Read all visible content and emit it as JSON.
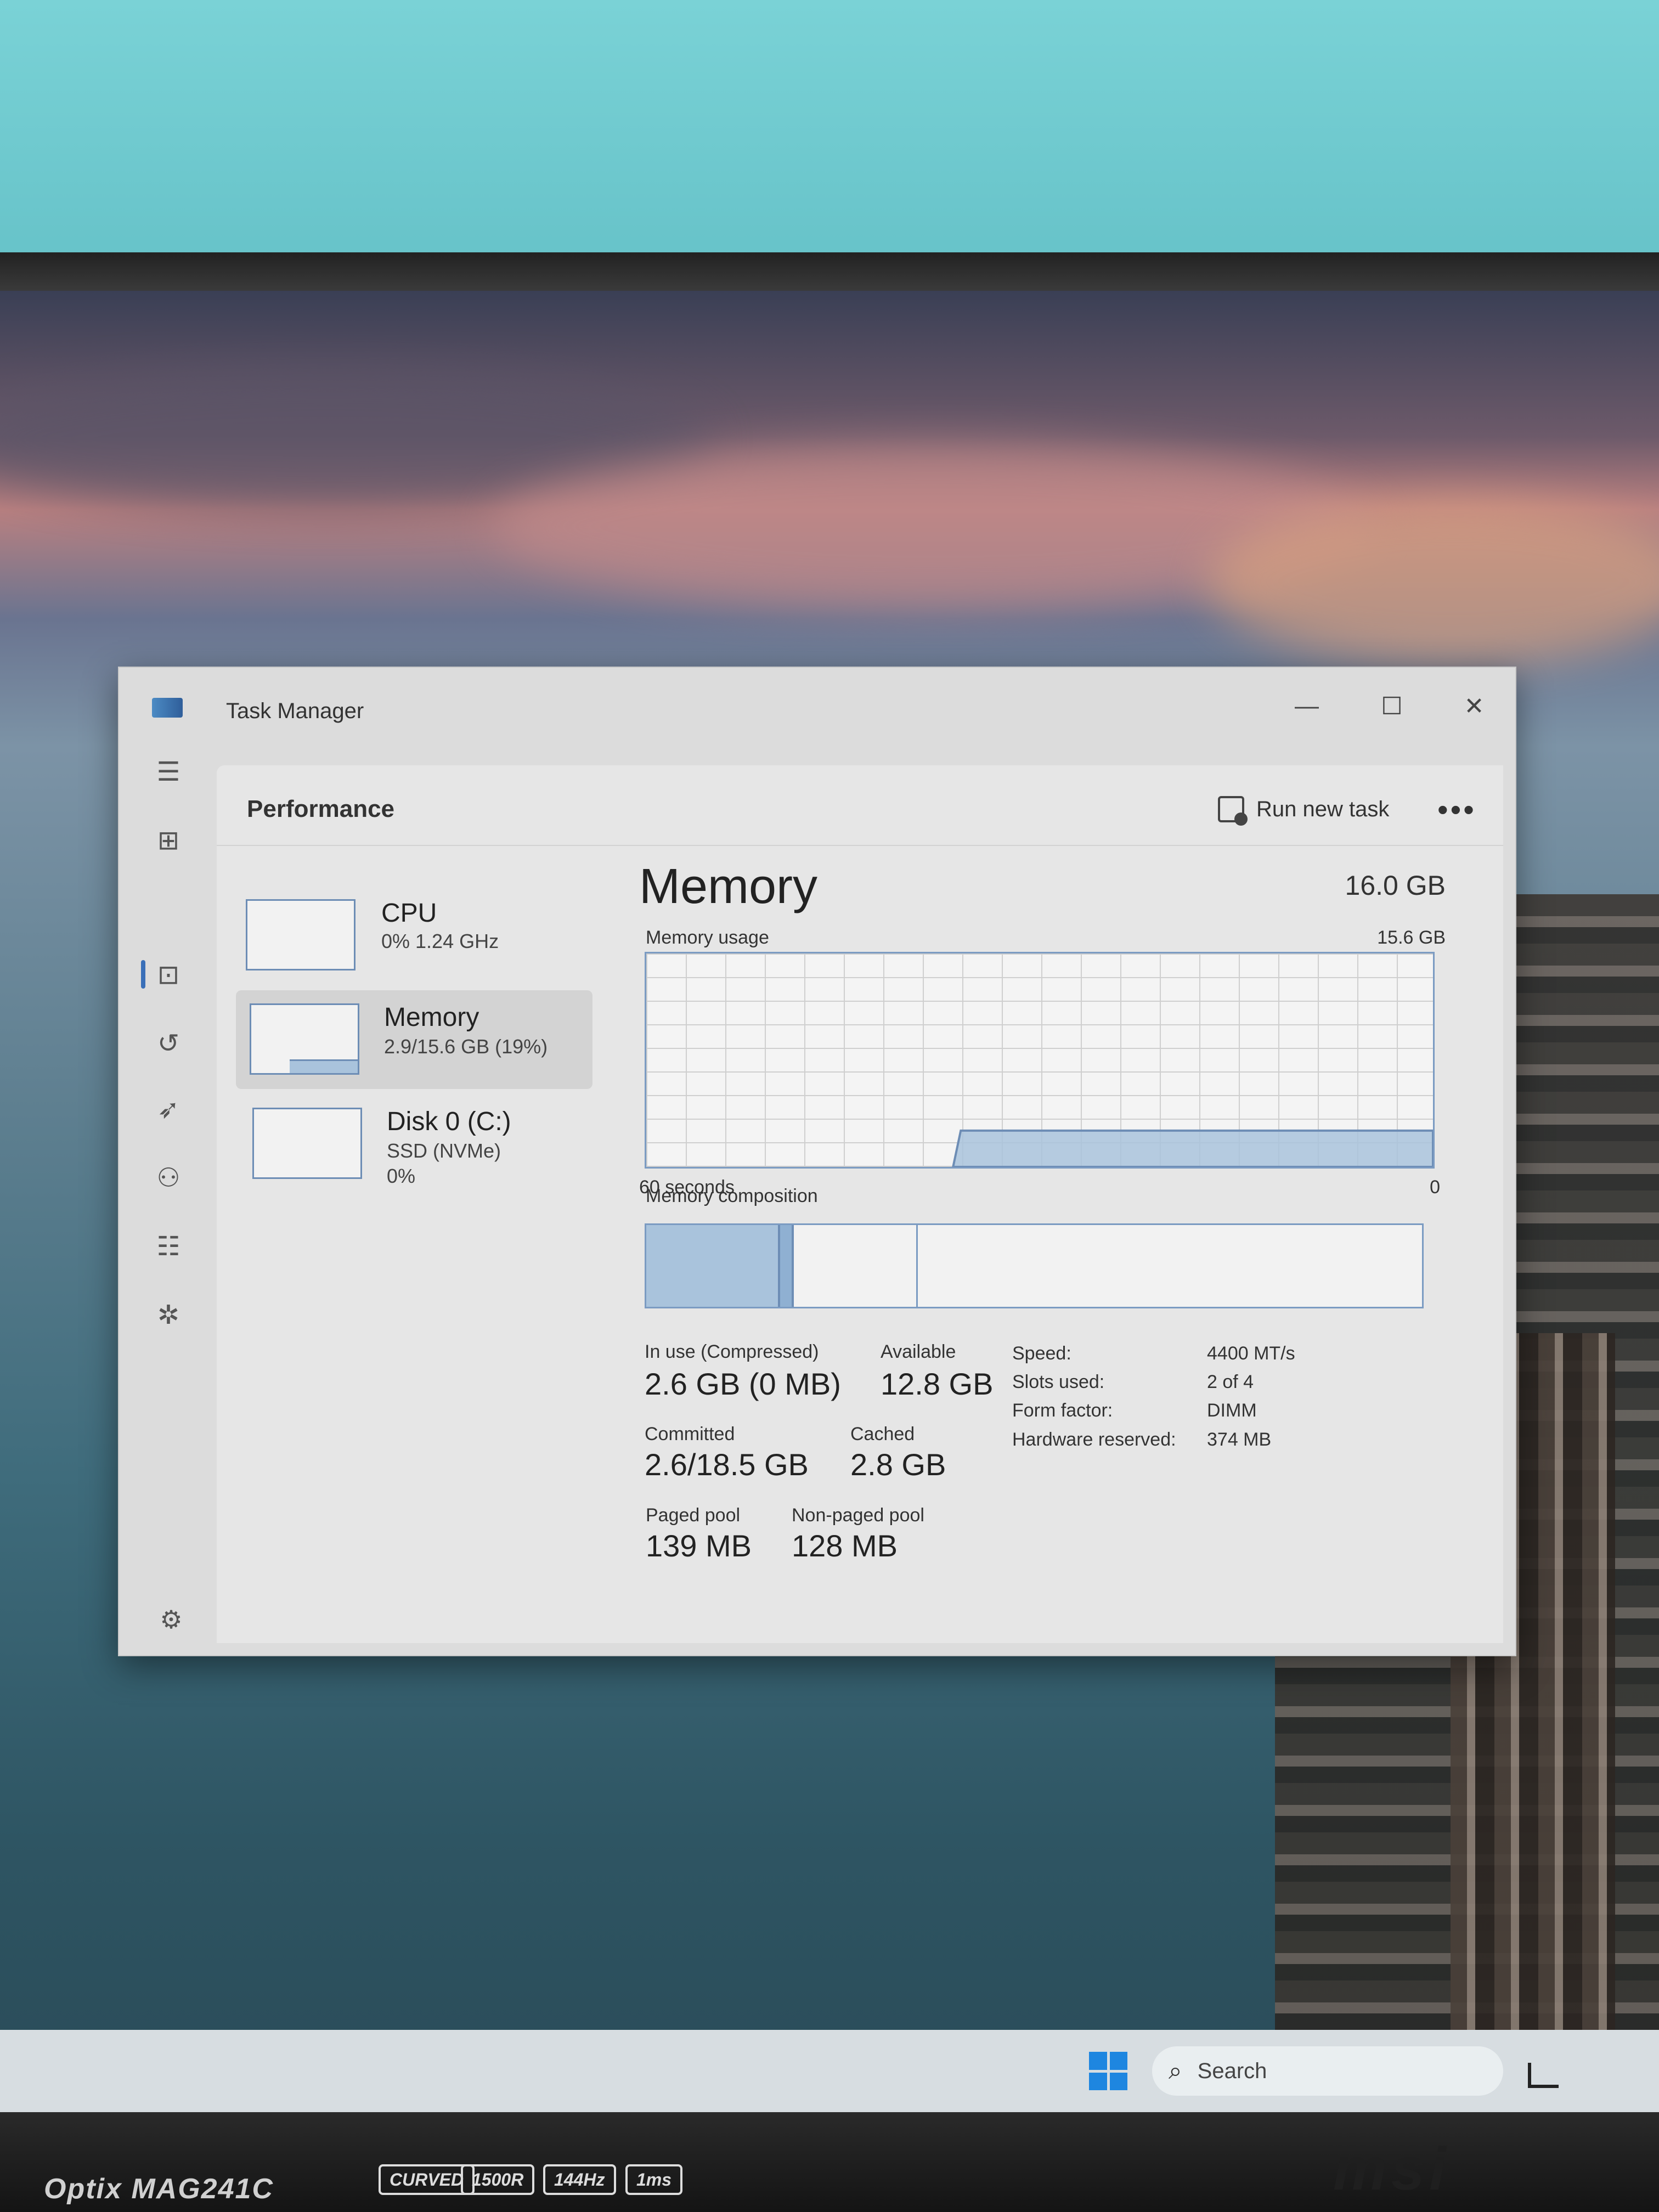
{
  "window": {
    "title": "Task Manager",
    "controls": {
      "minimize": "—",
      "maximize": "☐",
      "close": "✕"
    }
  },
  "nav": {
    "icons": [
      "hamburger-menu-icon",
      "processes-icon",
      "performance-icon",
      "app-history-icon",
      "startup-apps-icon",
      "users-icon",
      "details-icon",
      "services-icon",
      "settings-icon"
    ],
    "active": "performance"
  },
  "header": {
    "page_title": "Performance",
    "run_new_task": "Run new task",
    "more": "•••"
  },
  "devices": [
    {
      "name": "CPU",
      "line1": "0% 1.24 GHz",
      "line2": ""
    },
    {
      "name": "Memory",
      "line1": "2.9/15.6 GB (19%)",
      "line2": ""
    },
    {
      "name": "Disk 0 (C:)",
      "line1": "SSD (NVMe)",
      "line2": "0%"
    }
  ],
  "memory": {
    "title": "Memory",
    "total": "16.0 GB",
    "usage_label": "Memory usage",
    "usage_max": "15.6 GB",
    "time_left": "60 seconds",
    "time_right": "0",
    "composition_label": "Memory composition",
    "usage_fraction": 0.17,
    "composition": {
      "in_use_fraction": 0.17,
      "modified_fraction": 0.02,
      "standby_fraction": 0.16
    },
    "stats": {
      "in_use_label": "In use (Compressed)",
      "in_use_value": "2.6 GB (0 MB)",
      "available_label": "Available",
      "available_value": "12.8 GB",
      "committed_label": "Committed",
      "committed_value": "2.6/18.5 GB",
      "cached_label": "Cached",
      "cached_value": "2.8 GB",
      "paged_pool_label": "Paged pool",
      "paged_pool_value": "139 MB",
      "non_paged_pool_label": "Non-paged pool",
      "non_paged_pool_value": "128 MB"
    },
    "properties": [
      {
        "key": "Speed:",
        "value": "4400 MT/s"
      },
      {
        "key": "Slots used:",
        "value": "2 of 4"
      },
      {
        "key": "Form factor:",
        "value": "DIMM"
      },
      {
        "key": "Hardware reserved:",
        "value": "374 MB"
      }
    ]
  },
  "taskbar": {
    "search_placeholder": "Search"
  },
  "monitor": {
    "model": "Optix MAG241C",
    "badges": [
      "CURVED",
      "1500R",
      "144Hz",
      "1ms"
    ],
    "brand": "msi"
  },
  "colors": {
    "accent": "#3a6fb8",
    "graph_line": "#7b9bc2",
    "graph_fill": "#a9c3dc",
    "window_bg": "#dcdcdc"
  }
}
